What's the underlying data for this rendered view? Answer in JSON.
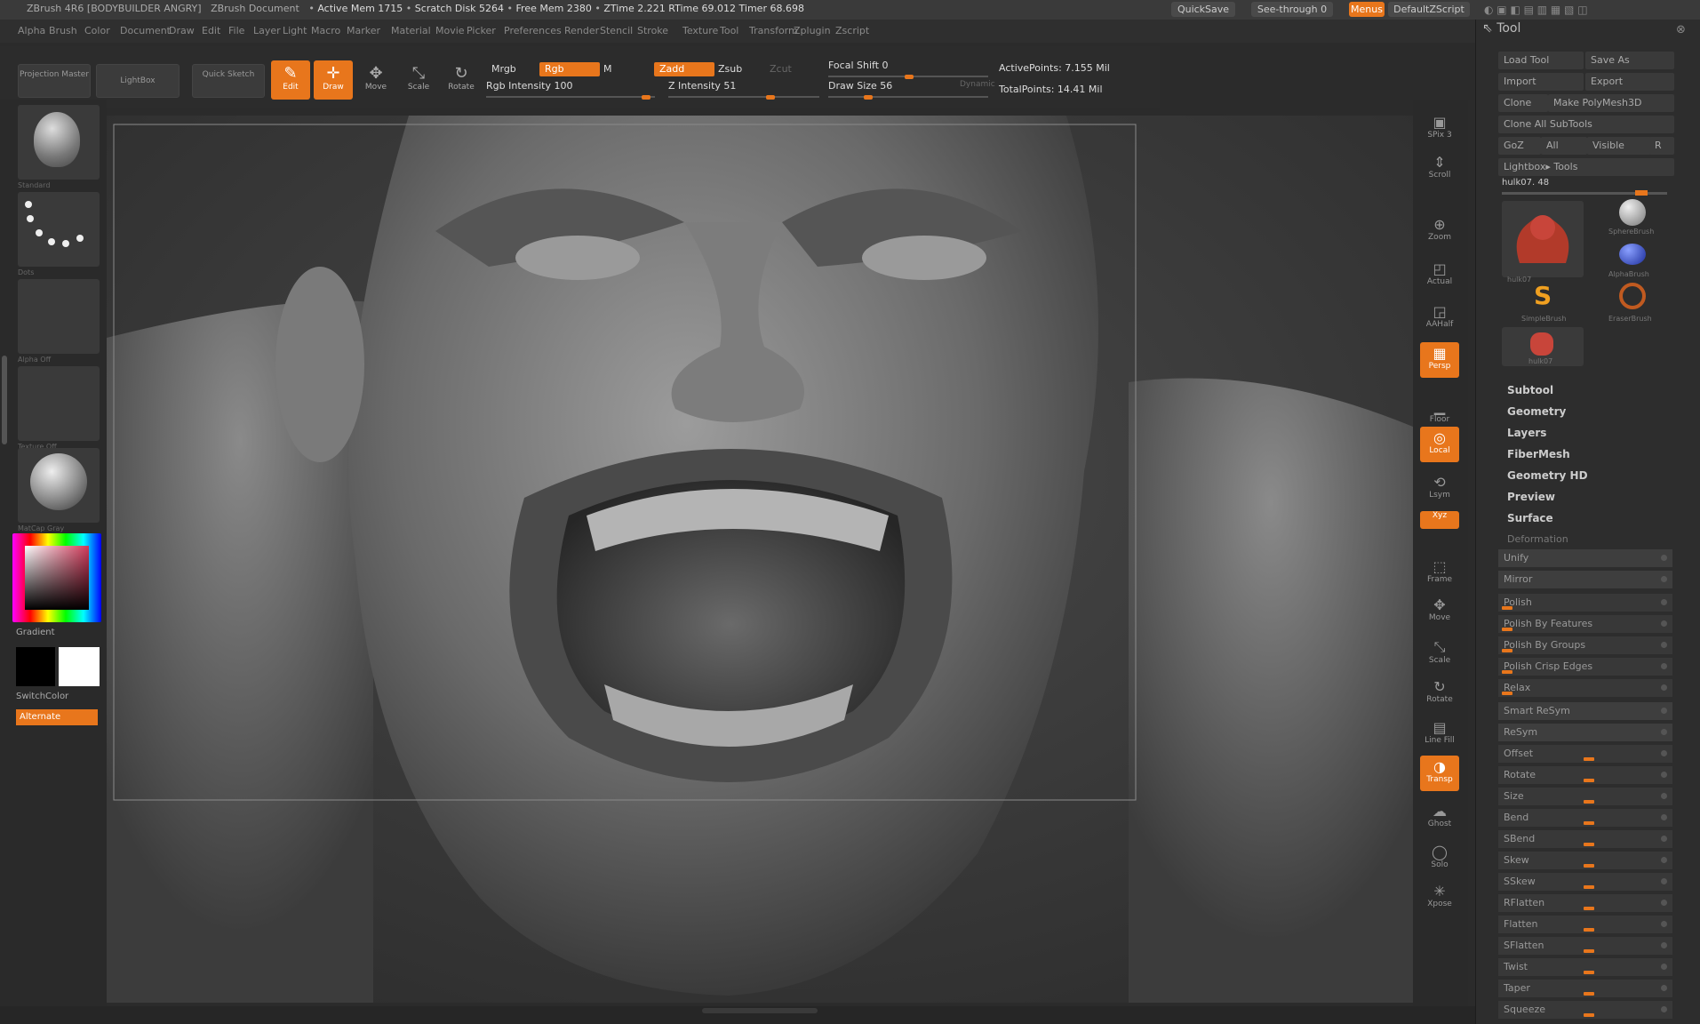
{
  "titlebar": {
    "app_text": "ZBrush 4R6 [BODYBUILDER ANGRY]",
    "doc": "ZBrush Document",
    "status_left": "Active Mem 1715",
    "status_scratch": "Scratch Disk 5264",
    "status_free": "Free Mem 2380",
    "status_ztime": "ZTime 2.221",
    "status_rtime": "RTime 69.012",
    "status_timer": "Timer 68.698",
    "quicksave": "QuickSave",
    "see_through": "See-through 0",
    "menus_btn": "Menus",
    "script": "DefaultZScript"
  },
  "menus": [
    "Alpha",
    "Brush",
    "Color",
    "Document",
    "Draw",
    "Edit",
    "File",
    "Layer",
    "Light",
    "Macro",
    "Marker",
    "Material",
    "Movie",
    "Picker",
    "Preferences",
    "Render",
    "Stencil",
    "Stroke",
    "Texture",
    "Tool",
    "Transform",
    "Zplugin",
    "Zscript"
  ],
  "toolbar": {
    "projection_master": "Projection Master",
    "lightbox": "LightBox",
    "quick_sketch": "Quick Sketch",
    "edit": "Edit",
    "draw": "Draw",
    "move": "Move",
    "scale": "Scale",
    "rotate": "Rotate",
    "mrgb": "Mrgb",
    "rgb": "Rgb",
    "m": "M",
    "zadd": "Zadd",
    "zsub": "Zsub",
    "zcut": "Zcut",
    "rgb_intensity": "Rgb Intensity 100",
    "z_intensity": "Z Intensity 51",
    "focal_shift": "Focal Shift 0",
    "draw_size": "Draw Size 56",
    "dynamic": "Dynamic",
    "active_points": "ActivePoints: 7.155 Mil",
    "total_points": "TotalPoints: 14.41 Mil"
  },
  "left_shelf": {
    "labels": [
      "Standard",
      "Dots",
      "Alpha Off",
      "Texture Off",
      "MatCap Gray"
    ],
    "gradient": "Gradient",
    "switch_color": "SwitchColor",
    "alternate": "Alternate"
  },
  "right_shelf": [
    "SPix 3",
    "Scroll",
    "Zoom",
    "Actual",
    "AAHalf",
    "Persp",
    "Floor",
    "Local",
    "Lsym",
    "Xyz",
    "Frame",
    "Move",
    "Scale",
    "Rotate",
    "Line Fill",
    "Transp",
    "Ghost",
    "Solo",
    "Xpose"
  ],
  "palette": {
    "title": "Tool",
    "load_tool": "Load Tool",
    "save_as": "Save As",
    "import": "Import",
    "export": "Export",
    "clone": "Clone",
    "make_polymesh": "Make PolyMesh3D",
    "clone_all": "Clone All SubTools",
    "goz": "GoZ",
    "all": "All",
    "visible": "Visible",
    "r": "R",
    "lightbox_tools": "Lightbox▸ Tools",
    "current_tool": "hulk07. 48",
    "tools": [
      "hulk07",
      "SphereBrush",
      "AlphaBrush",
      "SimpleBrush",
      "EraserBrush",
      "hulk07"
    ],
    "sections": [
      "Subtool",
      "Geometry",
      "Layers",
      "FiberMesh",
      "Geometry HD",
      "Preview",
      "Surface",
      "Deformation"
    ],
    "deform_rows": [
      "Unify",
      "Mirror",
      "Polish",
      "Polish By Features",
      "Polish By Groups",
      "Polish Crisp Edges",
      "Relax",
      "Smart ReSym",
      "ReSym",
      "Offset",
      "Rotate",
      "Size",
      "Bend",
      "SBend",
      "Skew",
      "SSkew",
      "RFlatten",
      "Flatten",
      "SFlatten",
      "Twist",
      "Taper",
      "Squeeze"
    ]
  }
}
